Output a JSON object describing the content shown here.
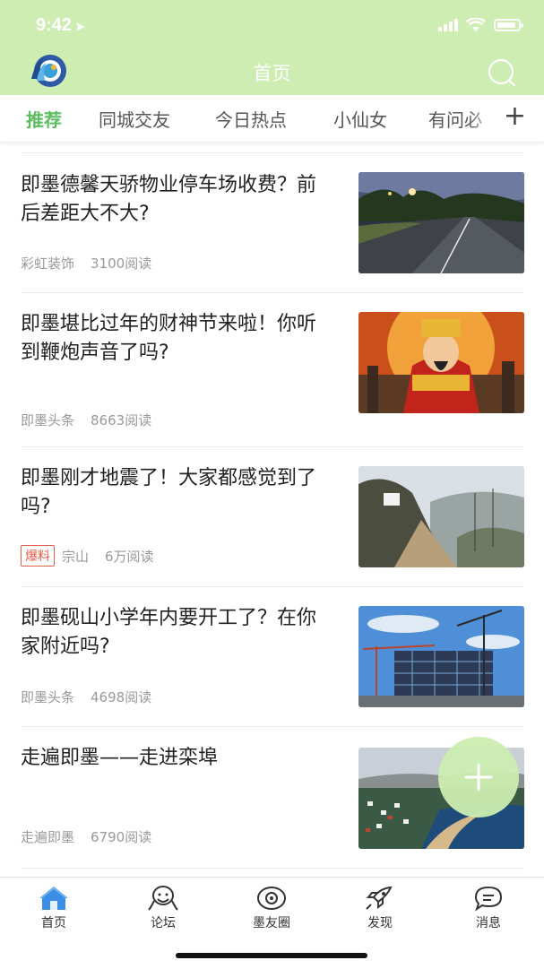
{
  "status_bar": {
    "time": "9:42",
    "location_icon": "location-arrow-icon"
  },
  "nav": {
    "title": "首页",
    "logo_icon": "app-logo-icon",
    "search_icon": "search-icon"
  },
  "tabs": {
    "items": [
      "推荐",
      "同城交友",
      "今日热点",
      "小仙女",
      "有问必"
    ],
    "active_index": 0,
    "add_icon": "plus-icon",
    "accent": "#5cbf5f"
  },
  "articles": [
    {
      "title": "即墨德馨天骄物业停车场收费？前后差距大不大?",
      "source": "彩虹装饰",
      "reads": "3100阅读",
      "tag": ""
    },
    {
      "title": "即墨堪比过年的财神节来啦！你听到鞭炮声音了吗?",
      "source": "即墨头条",
      "reads": "8663阅读",
      "tag": ""
    },
    {
      "title": "即墨刚才地震了！大家都感觉到了吗?",
      "source": "宗山",
      "reads": "6万阅读",
      "tag": "爆料"
    },
    {
      "title": "即墨砚山小学年内要开工了？在你家附近吗?",
      "source": "即墨头条",
      "reads": "4698阅读",
      "tag": ""
    },
    {
      "title": "走遍即墨——走进栾埠",
      "source": "走遍即墨",
      "reads": "6790阅读",
      "tag": ""
    }
  ],
  "fab": {
    "icon": "plus-icon"
  },
  "tabbar": {
    "items": [
      {
        "label": "首页",
        "icon": "home-icon"
      },
      {
        "label": "论坛",
        "icon": "forum-icon"
      },
      {
        "label": "墨友圈",
        "icon": "circle-icon"
      },
      {
        "label": "发现",
        "icon": "rocket-icon"
      },
      {
        "label": "消息",
        "icon": "message-icon"
      }
    ],
    "active_index": 0
  },
  "colors": {
    "header_bg": "#cdedb3",
    "accent": "#5cbf5f",
    "hot_tag": "#e55c48"
  }
}
